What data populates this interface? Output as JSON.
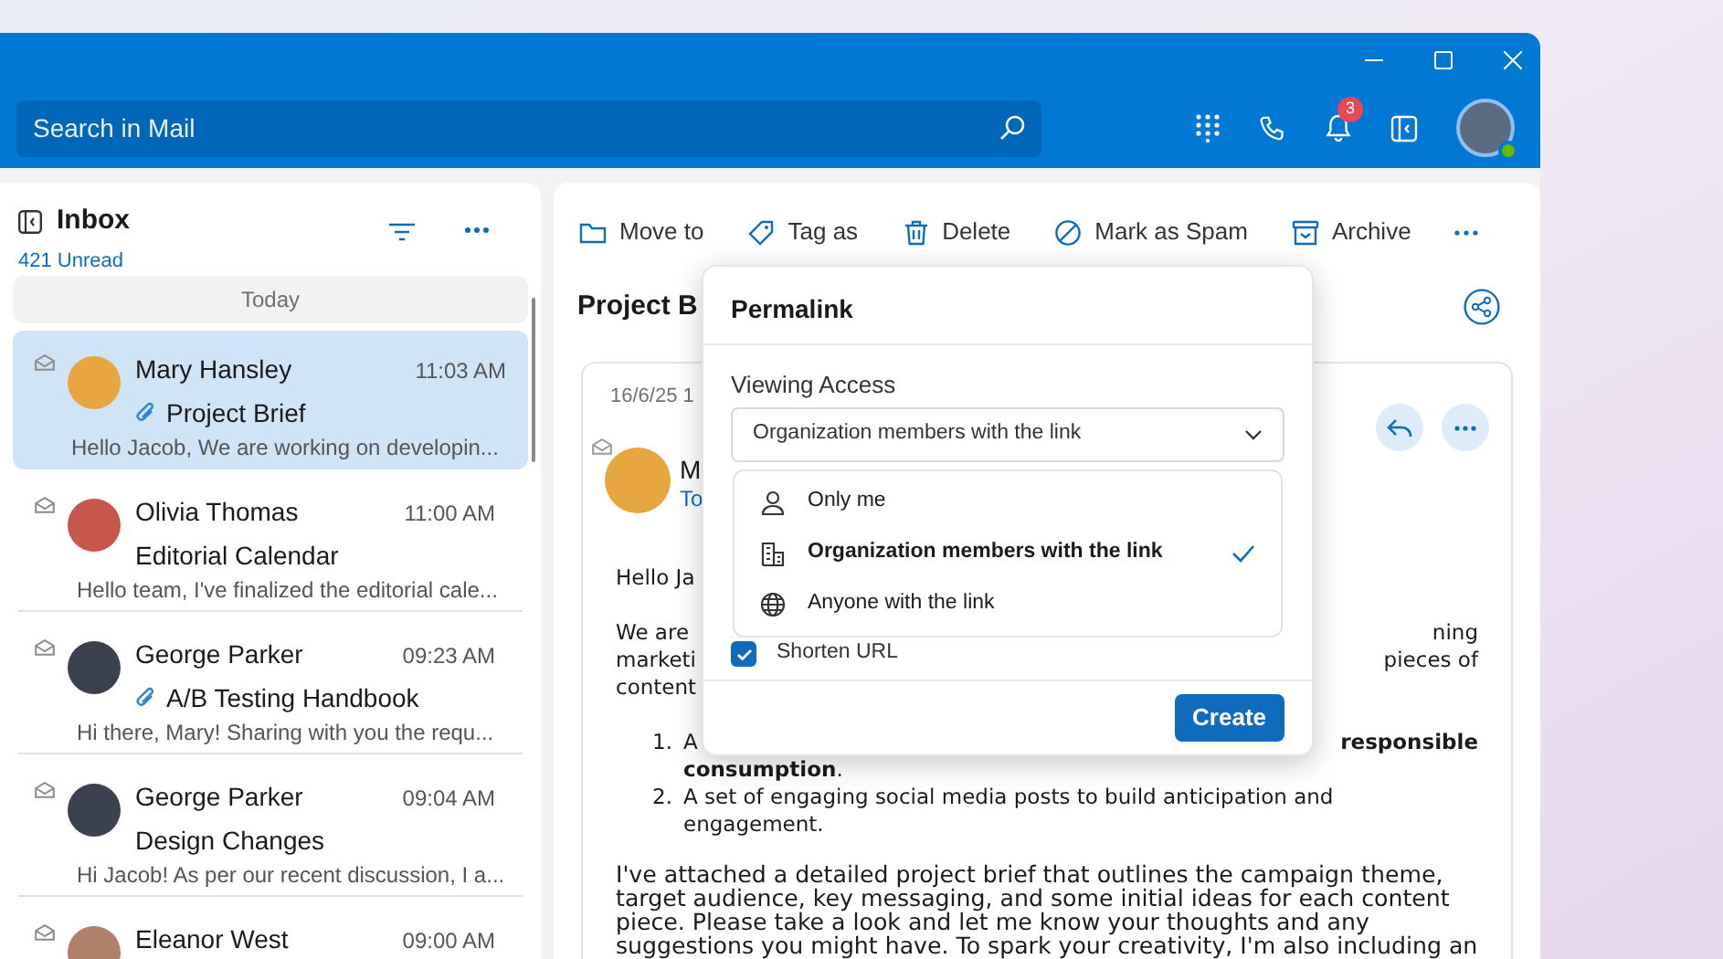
{
  "search": {
    "placeholder": "Search in Mail"
  },
  "notifications": {
    "badge": "3"
  },
  "user": {
    "online": true
  },
  "folder": {
    "title": "Inbox",
    "unread": "421 Unread"
  },
  "group": "Today",
  "messages": [
    {
      "sender": "Mary Hansley",
      "time": "11:03 AM",
      "subject": "Project Brief",
      "attachment": true,
      "preview": "Hello Jacob, We are working on developin...",
      "selected": true
    },
    {
      "sender": "Olivia Thomas",
      "time": "11:00 AM",
      "subject": "Editorial Calendar",
      "attachment": false,
      "preview": "Hello team, I've finalized the editorial cale...",
      "selected": false
    },
    {
      "sender": "George Parker",
      "time": "09:23 AM",
      "subject": "A/B Testing Handbook",
      "attachment": true,
      "preview": "Hi there, Mary! Sharing with you the requ...",
      "selected": false
    },
    {
      "sender": "George Parker",
      "time": "09:04 AM",
      "subject": "Design Changes",
      "attachment": false,
      "preview": "Hi Jacob! As per our recent discussion, I a...",
      "selected": false
    },
    {
      "sender": "Eleanor West",
      "time": "09:00 AM",
      "selected": false
    }
  ],
  "toolbar": [
    {
      "kind": "folder",
      "label": "Move to"
    },
    {
      "kind": "tag",
      "label": "Tag as"
    },
    {
      "kind": "trash",
      "label": "Delete"
    },
    {
      "kind": "spam",
      "label": "Mark as Spam"
    },
    {
      "kind": "archive",
      "label": "Archive"
    }
  ],
  "email": {
    "subject": "Project B",
    "date": "16/6/25 1",
    "sender": "M",
    "to": "To",
    "body": [
      {
        "kind": "line",
        "left": "Hello Ja"
      },
      {
        "kind": "split",
        "lines": [
          {
            "left": "We are",
            "right": "ning"
          },
          {
            "left": "marketi",
            "right": "pieces of"
          },
          {
            "left": "content"
          }
        ]
      },
      {
        "kind": "list",
        "items": [
          {
            "number": "1.",
            "left": "A",
            "right": "responsible",
            "cont": "**consumption**."
          },
          {
            "number": "2.",
            "text": "A set of engaging social media posts to build anticipation and engagement."
          }
        ]
      },
      {
        "kind": "para",
        "text": "I've attached a detailed project brief that outlines the campaign theme, target audience, key messaging, and some initial ideas for each content piece. Please take a look and let me know your thoughts and any suggestions you might have. To spark your creativity, I'm also including an"
      }
    ]
  },
  "permalink": {
    "title": "Permalink",
    "access_label": "Viewing Access",
    "value": "Organization members with the link",
    "options": [
      {
        "kind": "person",
        "label": "Only me",
        "selected": false
      },
      {
        "kind": "org",
        "label": "Organization members with the link",
        "selected": true
      },
      {
        "kind": "globe",
        "label": "Anyone with the link",
        "selected": false
      }
    ],
    "shorten": {
      "label": "Shorten URL",
      "checked": true
    },
    "create": "Create"
  }
}
